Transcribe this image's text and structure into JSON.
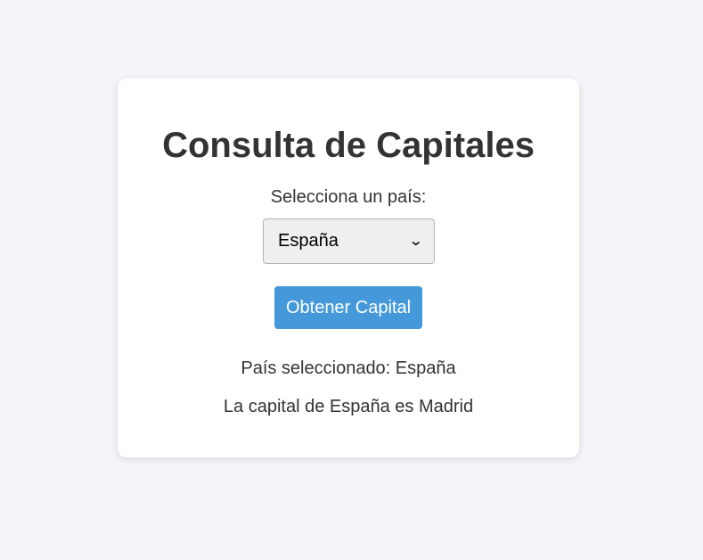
{
  "card": {
    "title": "Consulta de Capitales",
    "select_label": "Selecciona un país:",
    "selected_country": "España",
    "dropdown_icon": "chevron-down-icon",
    "button_label": "Obtener Capital",
    "selected_text": "País seleccionado: España",
    "result_text": "La capital de España es Madrid"
  },
  "colors": {
    "background": "#f4f4f9",
    "card": "#ffffff",
    "button": "#4598d9",
    "text": "#333333"
  }
}
